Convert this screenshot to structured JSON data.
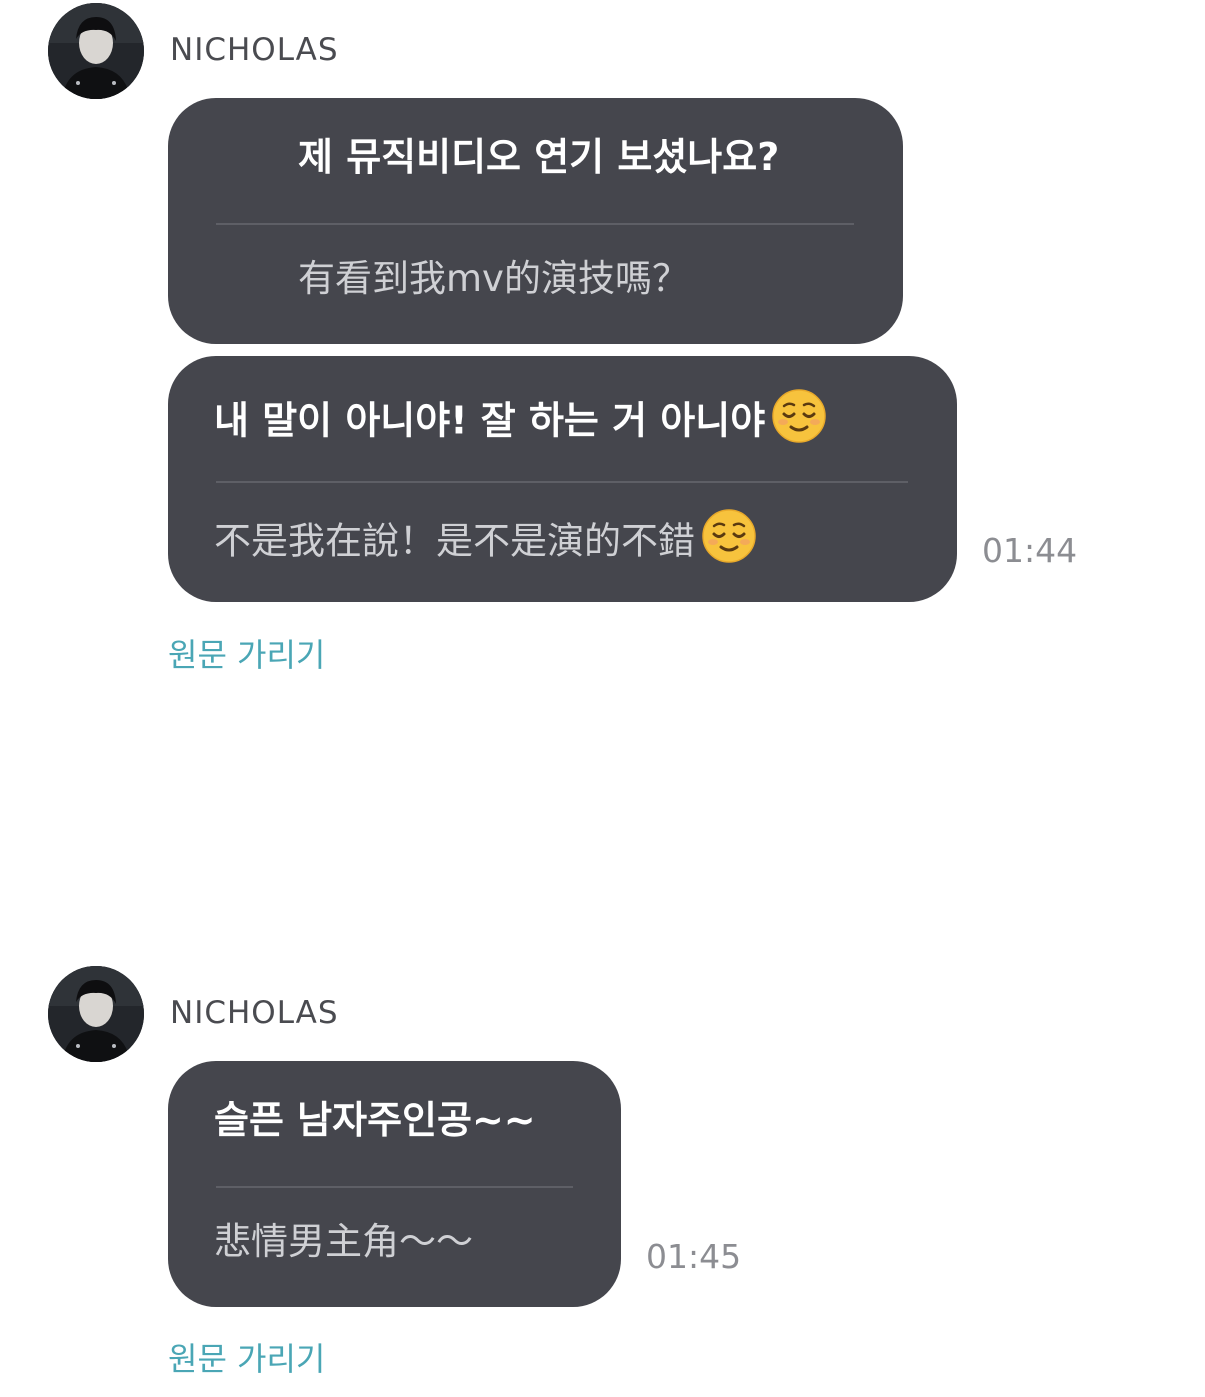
{
  "messages": [
    {
      "sender": "NICHOLAS",
      "bubbles": [
        {
          "original": "제 뮤직비디오 연기 보셨나요?",
          "translation": "有看到我mv的演技嗎？"
        },
        {
          "original": "내 말이 아니야! 잘 하는 거 아니야",
          "original_emoji": "relieved-face-emoji",
          "translation": "不是我在說！是不是演的不錯",
          "translation_emoji": "relieved-face-emoji",
          "time": "01:44"
        }
      ],
      "hide_original_label": "원문 가리기"
    },
    {
      "sender": "NICHOLAS",
      "bubbles": [
        {
          "original": "슬픈 남자주인공~~",
          "translation": "悲情男主角～～",
          "time": "01:45"
        }
      ],
      "hide_original_label": "원문 가리기"
    }
  ],
  "colors": {
    "bubble": "#45464d",
    "link": "#4aa6b5",
    "timestamp": "#8c8d92"
  }
}
